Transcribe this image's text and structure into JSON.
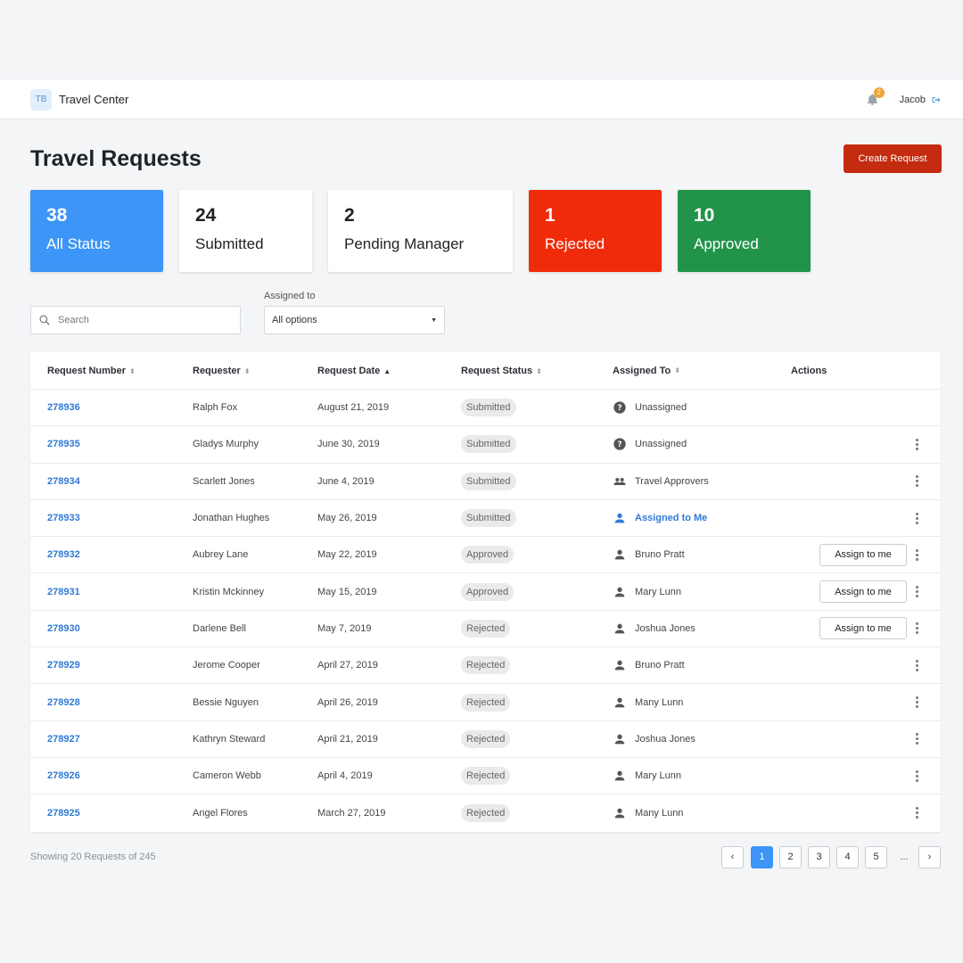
{
  "app": {
    "logo_text": "TB",
    "title": "Travel Center",
    "notifications_count": "2",
    "user": "Jacob"
  },
  "page": {
    "title": "Travel Requests",
    "create_label": "Create Request"
  },
  "cards": [
    {
      "count": "38",
      "label": "All Status",
      "color": "#3c95f7"
    },
    {
      "count": "24",
      "label": "Submitted",
      "color": "#ffffff"
    },
    {
      "count": "2",
      "label": "Pending Manager",
      "color": "#ffffff"
    },
    {
      "count": "1",
      "label": "Rejected",
      "color": "#f02b0a"
    },
    {
      "count": "10",
      "label": "Approved",
      "color": "#21944a"
    }
  ],
  "filters": {
    "search_placeholder": "Search",
    "assigned_label": "Assigned to",
    "assigned_value": "All options"
  },
  "table": {
    "headers": [
      "Request Number",
      "Requester",
      "Request Date",
      "Request Status",
      "Assigned To",
      "Actions"
    ],
    "rows": [
      {
        "number": "278936",
        "requester": "Ralph Fox",
        "date": "August 21, 2019",
        "status": "Submitted",
        "assigned": "Unassigned",
        "assign_icon": "question-icon",
        "assign_button": "",
        "menu": false
      },
      {
        "number": "278935",
        "requester": "Gladys Murphy",
        "date": "June 30, 2019",
        "status": "Submitted",
        "assigned": "Unassigned",
        "assign_icon": "question-icon",
        "assign_button": "",
        "menu": true
      },
      {
        "number": "278934",
        "requester": "Scarlett Jones",
        "date": "June 4, 2019",
        "status": "Submitted",
        "assigned": "Travel Approvers",
        "assign_icon": "group-icon",
        "assign_button": "",
        "menu": true
      },
      {
        "number": "278933",
        "requester": "Jonathan Hughes",
        "date": "May 26, 2019",
        "status": "Submitted",
        "assigned": "Assigned to Me",
        "assign_icon": "person-icon-blue",
        "assign_button": "",
        "menu": true
      },
      {
        "number": "278932",
        "requester": "Aubrey Lane",
        "date": "May 22, 2019",
        "status": "Approved",
        "assigned": "Bruno Pratt",
        "assign_icon": "person-icon",
        "assign_button": "Assign to me",
        "menu": true
      },
      {
        "number": "278931",
        "requester": "Kristin Mckinney",
        "date": "May 15, 2019",
        "status": "Approved",
        "assigned": "Mary Lunn",
        "assign_icon": "person-icon",
        "assign_button": "Assign to me",
        "menu": true
      },
      {
        "number": "278930",
        "requester": "Darlene Bell",
        "date": "May 7, 2019",
        "status": "Rejected",
        "assigned": "Joshua Jones",
        "assign_icon": "person-icon",
        "assign_button": "Assign to me",
        "menu": true
      },
      {
        "number": "278929",
        "requester": "Jerome Cooper",
        "date": "April 27, 2019",
        "status": "Rejected",
        "assigned": "Bruno Pratt",
        "assign_icon": "person-icon",
        "assign_button": "",
        "menu": true
      },
      {
        "number": "278928",
        "requester": "Bessie Nguyen",
        "date": "April 26, 2019",
        "status": "Rejected",
        "assigned": "Many Lunn",
        "assign_icon": "person-icon",
        "assign_button": "",
        "menu": true
      },
      {
        "number": "278927",
        "requester": "Kathryn Steward",
        "date": "April 21, 2019",
        "status": "Rejected",
        "assigned": "Joshua Jones",
        "assign_icon": "person-icon",
        "assign_button": "",
        "menu": true
      },
      {
        "number": "278926",
        "requester": "Cameron Webb",
        "date": "April 4, 2019",
        "status": "Rejected",
        "assigned": "Mary Lunn",
        "assign_icon": "person-icon",
        "assign_button": "",
        "menu": true
      },
      {
        "number": "278925",
        "requester": "Angel Flores",
        "date": "March 27, 2019",
        "status": "Rejected",
        "assigned": "Many Lunn",
        "assign_icon": "person-icon",
        "assign_button": "",
        "menu": true
      }
    ]
  },
  "footer": {
    "showing": "Showing 20 Requests of 245",
    "pages": [
      "1",
      "2",
      "3",
      "4",
      "5"
    ],
    "active_page": "1",
    "ellipsis": "...",
    "prev": "‹",
    "next": "›"
  }
}
